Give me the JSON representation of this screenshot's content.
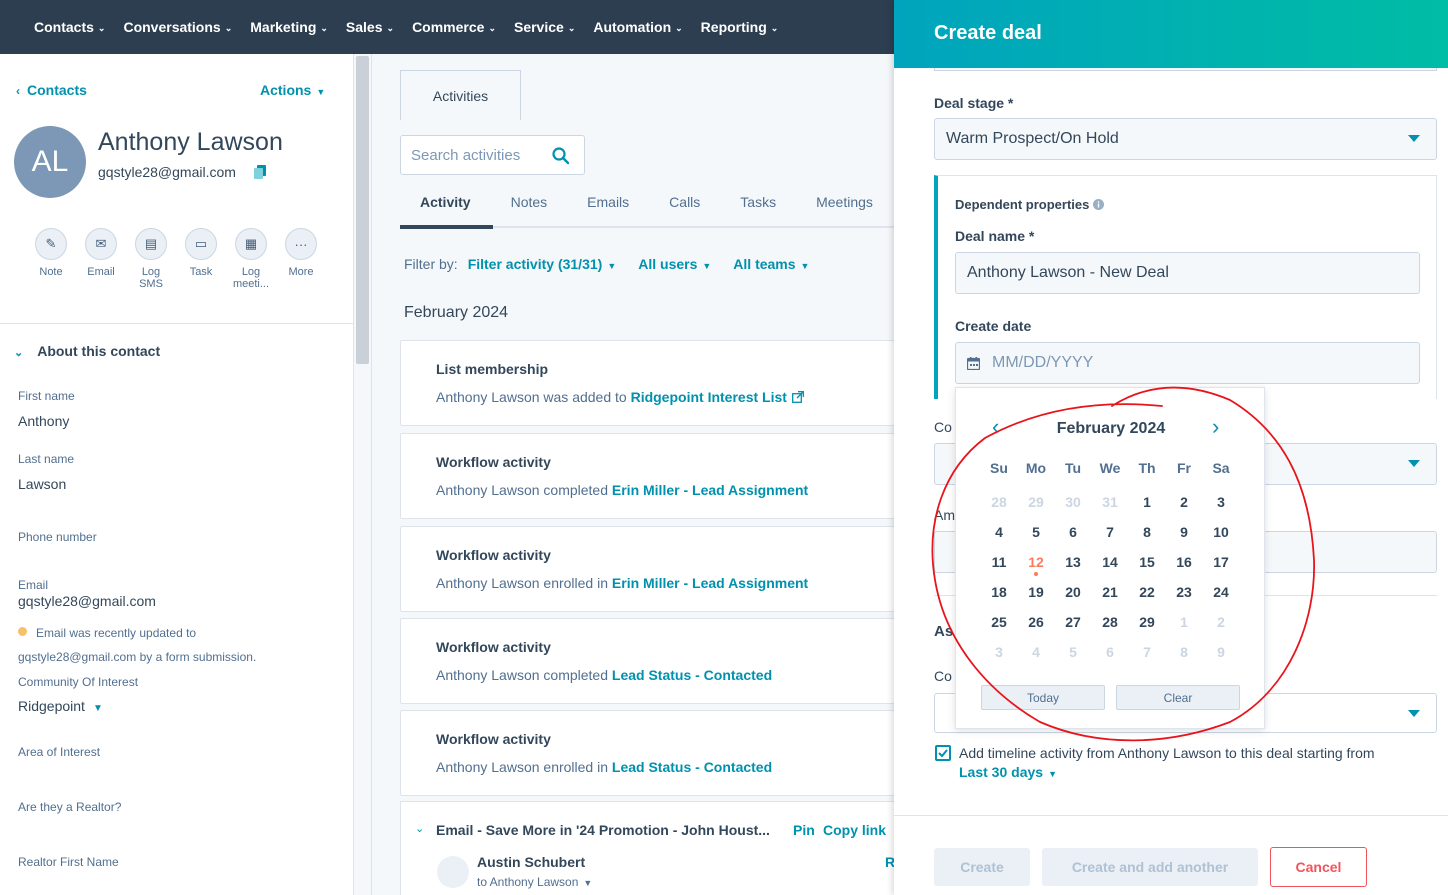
{
  "topnav": {
    "items": [
      "Contacts",
      "Conversations",
      "Marketing",
      "Sales",
      "Commerce",
      "Service",
      "Automation",
      "Reporting"
    ]
  },
  "sidebar": {
    "back_label": "Contacts",
    "actions_label": "Actions",
    "avatar_initials": "AL",
    "name": "Anthony Lawson",
    "email": "gqstyle28@gmail.com",
    "quick_actions": [
      {
        "label": "Note",
        "icon": "edit-icon"
      },
      {
        "label": "Email",
        "icon": "envelope-icon"
      },
      {
        "label": "Log SMS",
        "icon": "sms-icon"
      },
      {
        "label": "Task",
        "icon": "task-icon"
      },
      {
        "label": "Log meeti...",
        "icon": "calendar-icon"
      },
      {
        "label": "More",
        "icon": "more-icon"
      }
    ],
    "about_title": "About this contact",
    "props": {
      "first_name_label": "First name",
      "first_name": "Anthony",
      "last_name_label": "Last name",
      "last_name": "Lawson",
      "phone_label": "Phone number",
      "email_label": "Email",
      "email": "gqstyle28@gmail.com",
      "email_note_1": "Email was recently updated to",
      "email_note_2": "gqstyle28@gmail.com by a form submission.",
      "community_label": "Community Of Interest",
      "community": "Ridgepoint",
      "area_label": "Area of Interest",
      "realtor_label": "Are they a Realtor?",
      "realtor_first_label": "Realtor First Name"
    }
  },
  "middle": {
    "tab": "Activities",
    "search_placeholder": "Search activities",
    "subtabs": [
      "Activity",
      "Notes",
      "Emails",
      "Calls",
      "Tasks",
      "Meetings"
    ],
    "filter_label": "Filter by:",
    "filter_activity": "Filter activity (31/31)",
    "filter_users": "All users",
    "filter_teams": "All teams",
    "month": "February 2024",
    "cards": [
      {
        "title": "List membership",
        "prefix": "Anthony Lawson was added to ",
        "link": "Ridgepoint Interest List"
      },
      {
        "title": "Workflow activity",
        "prefix": "Anthony Lawson completed ",
        "link": "Erin Miller - Lead Assignment"
      },
      {
        "title": "Workflow activity",
        "prefix": "Anthony Lawson enrolled in ",
        "link": "Erin Miller - Lead Assignment"
      },
      {
        "title": "Workflow activity",
        "prefix": "Anthony Lawson completed ",
        "link": "Lead Status - Contacted"
      },
      {
        "title": "Workflow activity",
        "prefix": "Anthony Lawson enrolled in ",
        "link": "Lead Status - Contacted"
      }
    ],
    "email_card": {
      "title": "Email - Save More in '24 Promotion - John Houst...",
      "pin": "Pin",
      "copy_link": "Copy link",
      "sender": "Austin Schubert",
      "to": "to Anthony Lawson",
      "truncated_right": "R"
    }
  },
  "panel": {
    "title": "Create deal",
    "deal_stage_label": "Deal stage *",
    "deal_stage_value": "Warm Prospect/On Hold",
    "dependent_label": "Dependent properties",
    "deal_name_label": "Deal name *",
    "deal_name_value": "Anthony Lawson - New Deal",
    "create_date_label": "Create date",
    "create_date_placeholder": "MM/DD/YYYY",
    "hidden_label_1": "Co",
    "hidden_label_2": "Am",
    "hidden_label_3": "As",
    "hidden_label_4": "Co",
    "timeline_text": "Add timeline activity from Anthony Lawson to this deal starting from",
    "timeline_range": "Last 30 days",
    "create_btn": "Create",
    "create_another_btn": "Create and add another",
    "cancel_btn": "Cancel"
  },
  "calendar": {
    "month_label": "February 2024",
    "weekdays": [
      "Su",
      "Mo",
      "Tu",
      "We",
      "Th",
      "Fr",
      "Sa"
    ],
    "weeks": [
      [
        "28",
        "29",
        "30",
        "31",
        "1",
        "2",
        "3"
      ],
      [
        "4",
        "5",
        "6",
        "7",
        "8",
        "9",
        "10"
      ],
      [
        "11",
        "12",
        "13",
        "14",
        "15",
        "16",
        "17"
      ],
      [
        "18",
        "19",
        "20",
        "21",
        "22",
        "23",
        "24"
      ],
      [
        "25",
        "26",
        "27",
        "28",
        "29",
        "1",
        "2"
      ],
      [
        "3",
        "4",
        "5",
        "6",
        "7",
        "8",
        "9"
      ]
    ],
    "today": "12",
    "today_btn": "Today",
    "clear_btn": "Clear"
  },
  "colors": {
    "nav_bg": "#2d3e50",
    "accent": "#0091ae",
    "header_gradient_start": "#00a4bd",
    "header_gradient_end": "#00bda5",
    "today": "#ff7a59",
    "cancel": "#f2545b",
    "annotation": "#e8141b"
  }
}
